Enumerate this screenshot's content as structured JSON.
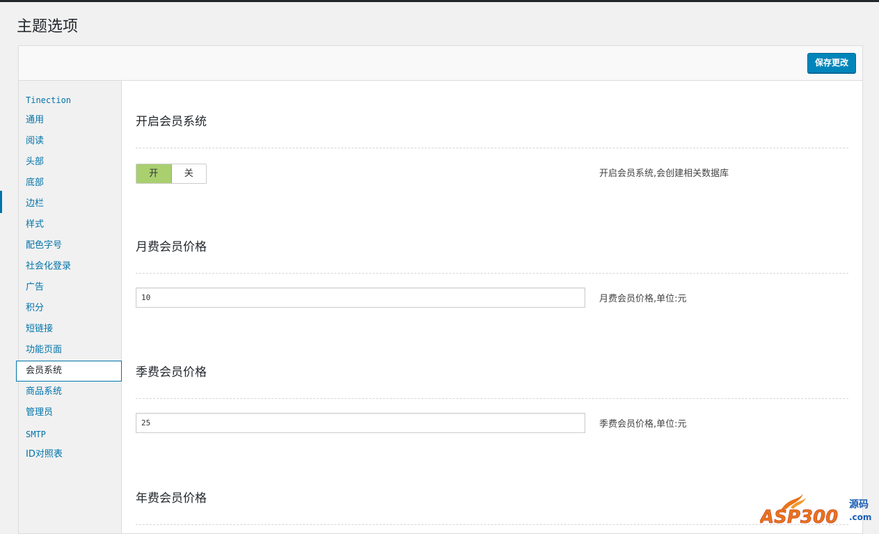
{
  "page": {
    "title": "主题选项"
  },
  "header": {
    "save_label": "保存更改"
  },
  "sidebar": {
    "items": [
      {
        "label": "Tinection"
      },
      {
        "label": "通用"
      },
      {
        "label": "阅读"
      },
      {
        "label": "头部"
      },
      {
        "label": "底部"
      },
      {
        "label": "边栏"
      },
      {
        "label": "样式"
      },
      {
        "label": "配色字号"
      },
      {
        "label": "社会化登录"
      },
      {
        "label": "广告"
      },
      {
        "label": "积分"
      },
      {
        "label": "短链接"
      },
      {
        "label": "功能页面"
      },
      {
        "label": "会员系统",
        "active": true
      },
      {
        "label": "商品系统"
      },
      {
        "label": "管理员"
      },
      {
        "label": "SMTP"
      },
      {
        "label": "ID对照表"
      }
    ]
  },
  "sections": {
    "membership": {
      "title": "开启会员系统",
      "toggle_on": "开",
      "toggle_off": "关",
      "selected": "开",
      "desc": "开启会员系统,会创建相关数据库"
    },
    "monthly": {
      "title": "月费会员价格",
      "value": "10",
      "desc": "月费会员价格,单位:元"
    },
    "quarterly": {
      "title": "季费会员价格",
      "value": "25",
      "desc": "季费会员价格,单位:元"
    },
    "yearly": {
      "title": "年费会员价格"
    }
  },
  "watermark": {
    "brand": "ASP300",
    "tag1": "源码",
    "tag2": ".com"
  },
  "colors": {
    "accent": "#0085ba",
    "toggle_on": "#a9cf6f",
    "link": "#0073aa"
  }
}
